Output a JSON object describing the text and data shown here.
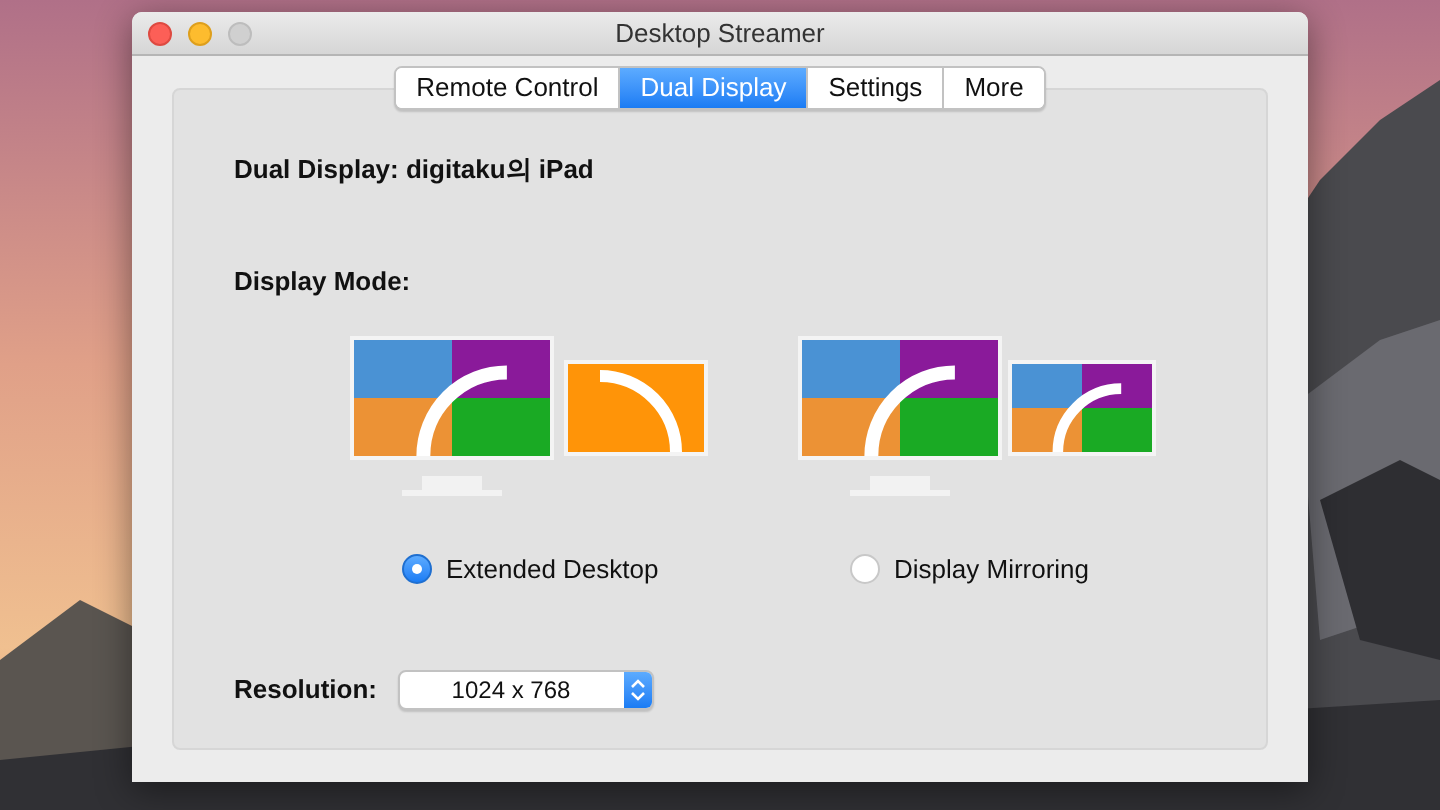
{
  "window": {
    "title": "Desktop Streamer"
  },
  "tabs": [
    {
      "label": "Remote Control",
      "selected": false
    },
    {
      "label": "Dual Display",
      "selected": true
    },
    {
      "label": "Settings",
      "selected": false
    },
    {
      "label": "More",
      "selected": false
    }
  ],
  "heading": "Dual Display: digitaku의 iPad",
  "mode_label": "Display Mode:",
  "modes": [
    {
      "kind": "extended",
      "label": "Extended Desktop",
      "selected": true
    },
    {
      "kind": "mirroring",
      "label": "Display Mirroring",
      "selected": false
    }
  ],
  "resolution": {
    "label": "Resolution:",
    "value": "1024 x 768"
  }
}
